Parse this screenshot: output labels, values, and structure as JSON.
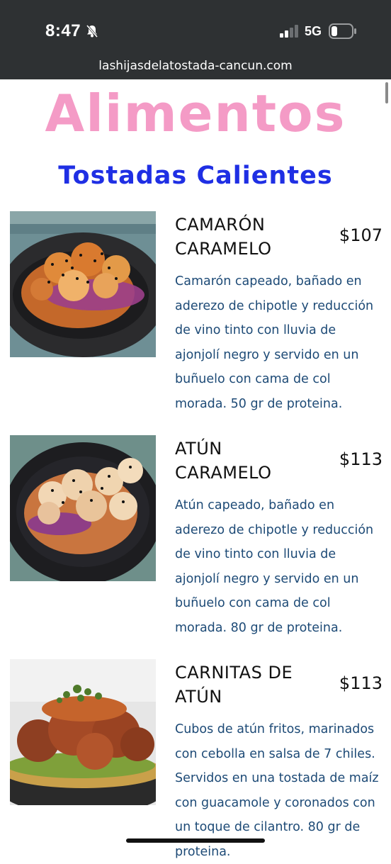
{
  "status_bar": {
    "time": "8:47",
    "network": "5G",
    "icons": [
      "bell-slash-icon",
      "signal-icon",
      "battery-icon"
    ]
  },
  "browser": {
    "url": "lashijasdelatostada-cancun.com"
  },
  "page": {
    "heading": "Alimentos",
    "subheading": "Tostadas Calientes",
    "colors": {
      "heading": "#f49bc6",
      "subheading": "#1f2fe4",
      "description": "#1d4a76",
      "status_bar": "#2e3133"
    }
  },
  "menu_items": [
    {
      "name_line1": "CAMARÓN",
      "name_line2": "CARAMELO",
      "price": "$107",
      "description": "Camarón capeado, bañado en aderezo de chipotle y reducción de vino tinto con lluvia de ajonjolí negro y servido en un buñuelo con cama de col morada. 50 gr de proteina."
    },
    {
      "name_line1": "ATÚN",
      "name_line2": "CARAMELO",
      "price": "$113",
      "description": "Atún capeado, bañado en aderezo de chipotle y reducción de vino tinto con lluvia de ajonjolí negro y servido en un buñuelo con cama de col morada. 80 gr de proteina."
    },
    {
      "name_line1": "CARNITAS DE",
      "name_line2": "ATÚN",
      "price": "$113",
      "description": "Cubos de atún fritos, marinados con cebolla en salsa de 7 chiles. Servidos en una tostada de maíz con guacamole y coronados con un toque de cilantro. 80 gr de proteina."
    }
  ]
}
